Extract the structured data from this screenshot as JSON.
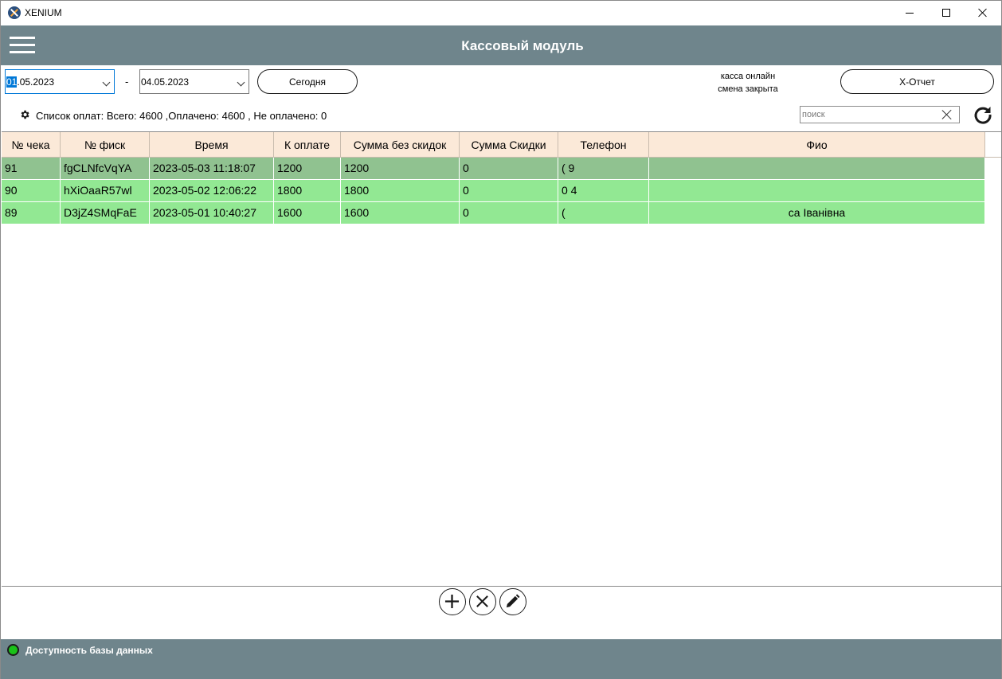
{
  "window": {
    "app_name": "XENIUM"
  },
  "header": {
    "title": "Кассовый модуль"
  },
  "filters": {
    "date_from_selected": "01",
    "date_from_rest": ".05.2023",
    "separator": "-",
    "date_to": "04.05.2023",
    "today_label": "Сегодня"
  },
  "kassa": {
    "line1": "касса онлайн",
    "line2": "смена закрыта",
    "xreport_label": "X-Отчет"
  },
  "summary": {
    "text": "Список оплат: Всего: 4600 ,Оплачено: 4600 , Не оплачено: 0"
  },
  "search": {
    "placeholder": "поиск"
  },
  "table": {
    "columns": [
      "№ чека",
      "№ фиск",
      "Время",
      "К оплате",
      "Сумма без скидок",
      "Сумма Скидки",
      "Телефон",
      "Фио"
    ],
    "rows": [
      {
        "check": "91",
        "fisk": "fgCLNfcVqYA",
        "time": "2023-05-03 11:18:07",
        "to_pay": "1200",
        "sum_no_disc": "1200",
        "disc": "0",
        "phone": "(                    9",
        "fio": ""
      },
      {
        "check": "90",
        "fisk": "hXiOaaR57wl",
        "time": "2023-05-02 12:06:22",
        "to_pay": "1800",
        "sum_no_disc": "1800",
        "disc": "0",
        "phone": "0                   4",
        "fio": ""
      },
      {
        "check": "89",
        "fisk": "D3jZ4SMqFaE",
        "time": "2023-05-01 10:40:27",
        "to_pay": "1600",
        "sum_no_disc": "1600",
        "disc": "0",
        "phone": "(",
        "fio": "са Іванівна"
      }
    ]
  },
  "status": {
    "db_label": "Доступность базы данных",
    "db_color": "#19c219"
  },
  "colors": {
    "header_bg": "#6f858c",
    "table_header_bg": "#fbe9d8",
    "row_selected_bg": "#90c290",
    "row_paid_bg": "#92e893"
  }
}
